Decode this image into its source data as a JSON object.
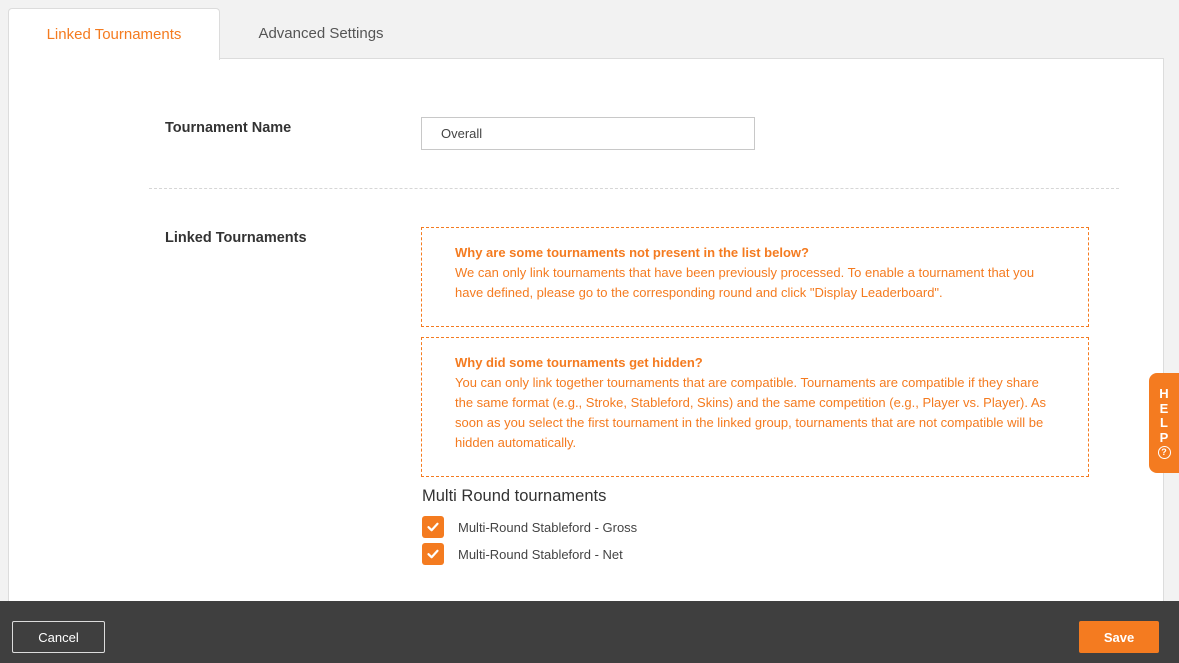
{
  "tabs": [
    {
      "label": "Linked Tournaments",
      "active": true
    },
    {
      "label": "Advanced Settings",
      "active": false
    }
  ],
  "form": {
    "tournament_name_label": "Tournament Name",
    "tournament_name_value": "Overall",
    "linked_tournaments_label": "Linked Tournaments"
  },
  "info_boxes": [
    {
      "question": "Why are some tournaments not present in the list below?",
      "answer": "We can only link tournaments that have been previously processed. To enable a tournament that you have defined, please go to the corresponding round and click \"Display Leaderboard\"."
    },
    {
      "question": "Why did some tournaments get hidden?",
      "answer": "You can only link together tournaments that are compatible. Tournaments are compatible if they share the same format (e.g., Stroke, Stableford, Skins) and the same competition (e.g., Player vs. Player). As soon as you select the first tournament in the linked group, tournaments that are not compatible will be hidden automatically."
    }
  ],
  "multi_round": {
    "title": "Multi Round tournaments",
    "items": [
      {
        "label": "Multi-Round Stableford - Gross",
        "checked": true
      },
      {
        "label": "Multi-Round Stableford - Net",
        "checked": true
      }
    ]
  },
  "help": {
    "letters": [
      "H",
      "E",
      "L",
      "P"
    ],
    "icon": "question-circle-icon"
  },
  "footer": {
    "cancel_label": "Cancel",
    "save_label": "Save"
  },
  "colors": {
    "accent": "#f47b20",
    "footer_bg": "#3f3f3f",
    "page_bg": "#f2f2f2"
  }
}
